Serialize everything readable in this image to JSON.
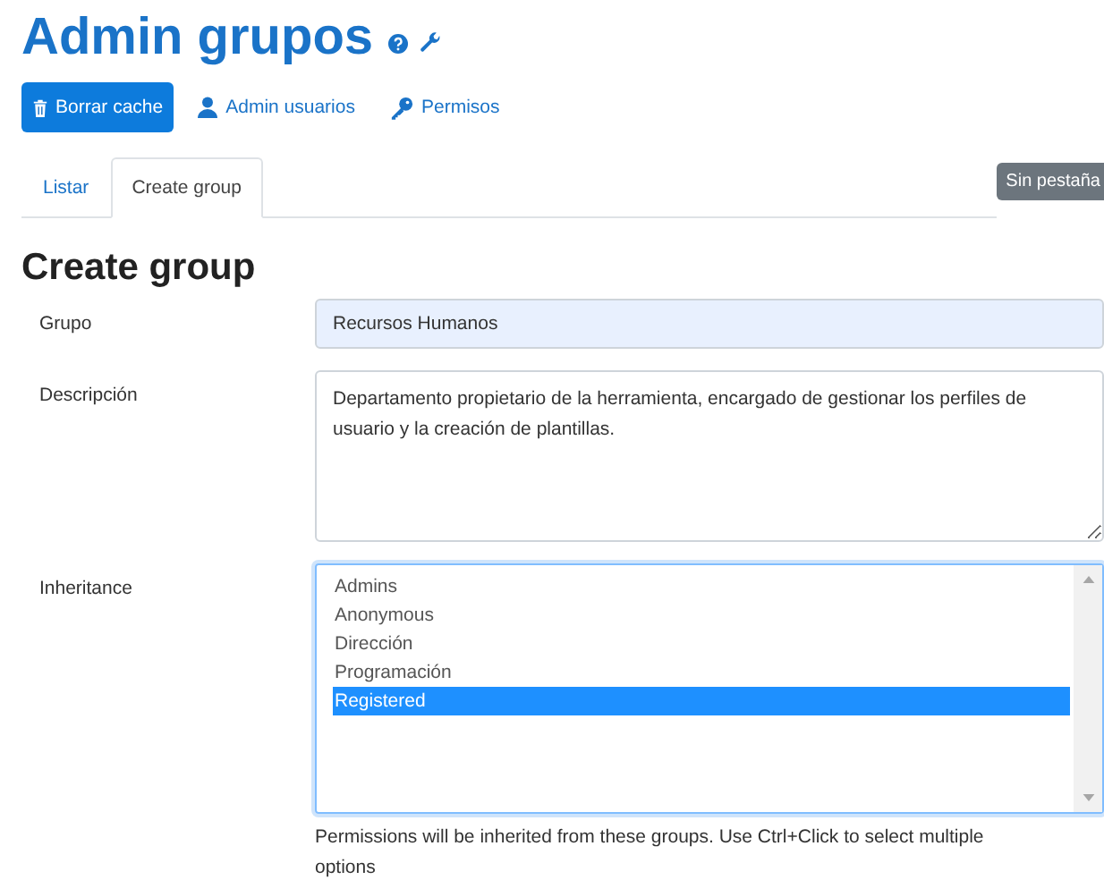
{
  "title": "Admin grupos",
  "toolbar": [
    {
      "label": "Borrar cache",
      "kind": "primary"
    },
    {
      "label": "Admin usuarios",
      "kind": "user"
    },
    {
      "label": "Permisos",
      "kind": "key"
    }
  ],
  "tabs": [
    {
      "label": "Listar",
      "selected": false
    },
    {
      "label": "Create group",
      "selected": true
    }
  ],
  "badge": "Sin pestaña",
  "form": {
    "heading": "Create group",
    "group_label": "Grupo",
    "group_value": "Recursos Humanos",
    "description_label": "Descripción",
    "description_value": "Departamento propietario de la herramienta, encargado de gestionar los perfiles de usuario y la creación de plantillas.",
    "inheritance_label": "Inheritance",
    "inheritance_options": [
      {
        "label": "Admins",
        "selected": false
      },
      {
        "label": "Anonymous",
        "selected": false
      },
      {
        "label": "Dirección",
        "selected": false
      },
      {
        "label": "Programación",
        "selected": false
      },
      {
        "label": "Registered",
        "selected": true
      }
    ],
    "help": "Permissions will be inherited from these groups. Use Ctrl+Click to select multiple options"
  }
}
